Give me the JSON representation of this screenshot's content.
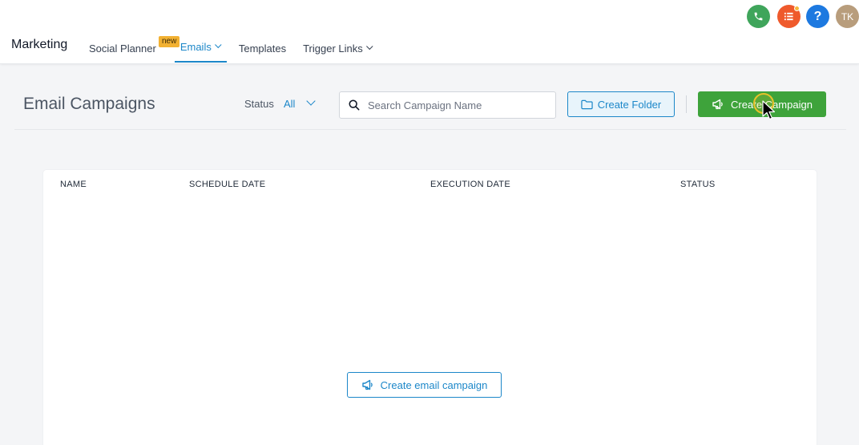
{
  "app": {
    "brand": "Marketing"
  },
  "nav": {
    "items": [
      {
        "label": "Social Planner",
        "badge": "new",
        "has_dropdown": false,
        "active": false
      },
      {
        "label": "Emails",
        "has_dropdown": true,
        "active": true
      },
      {
        "label": "Templates",
        "has_dropdown": false,
        "active": false
      },
      {
        "label": "Trigger Links",
        "has_dropdown": true,
        "active": false
      }
    ]
  },
  "top_icons": {
    "phone_icon": "phone-icon",
    "tasks_icon": "list-icon",
    "help_label": "?",
    "avatar_initials": "TK"
  },
  "header": {
    "title": "Email Campaigns",
    "status_label": "Status",
    "status_value": "All",
    "search_placeholder": "Search Campaign Name",
    "create_folder_label": "Create Folder",
    "create_campaign_label": "Create Campaign"
  },
  "table": {
    "columns": [
      "NAME",
      "SCHEDULE DATE",
      "EXECUTION DATE",
      "STATUS"
    ],
    "rows": []
  },
  "empty_state": {
    "button_label": "Create email campaign"
  },
  "colors": {
    "accent": "#1c87c9",
    "primary_button": "#3ea33b",
    "badge_new": "#f2b132",
    "phone": "#3fa55b",
    "tasks": "#ef5a2c",
    "help": "#1d79e0",
    "avatar": "#b89d7c"
  }
}
